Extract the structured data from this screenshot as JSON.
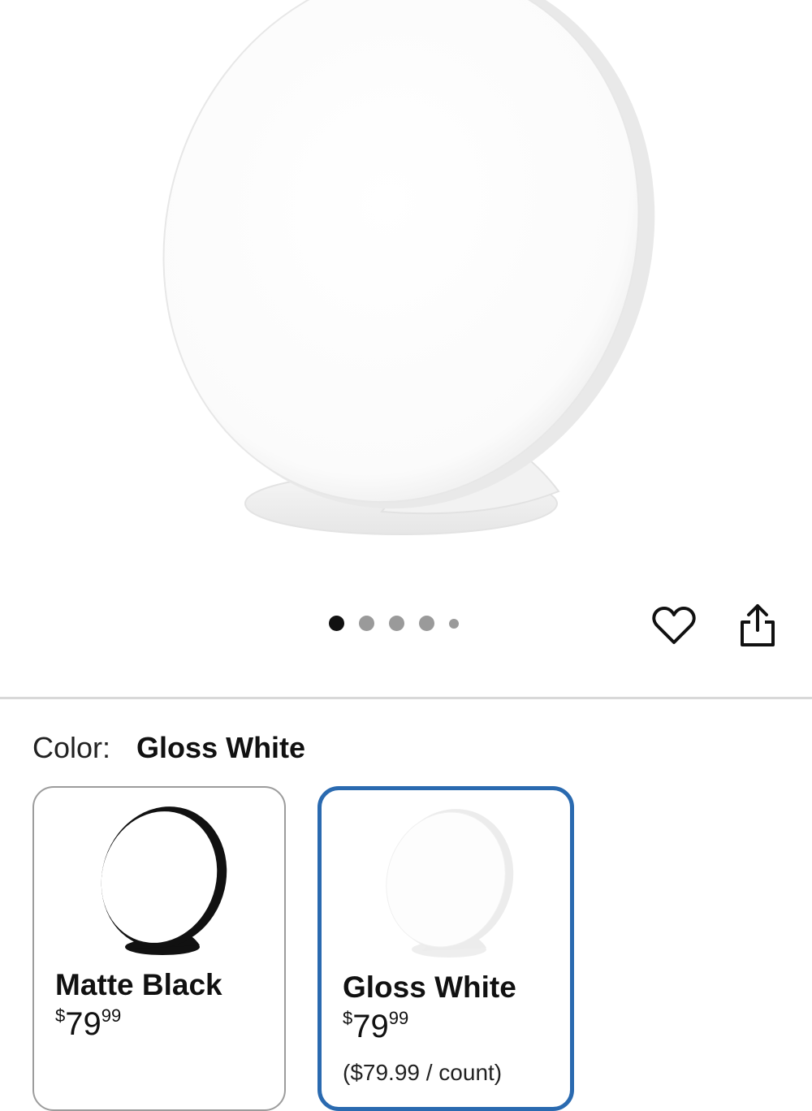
{
  "product_gallery": {
    "image_alt": "Gloss White light therapy lamp",
    "dots_count": 5,
    "active_dot": 0
  },
  "actions": {
    "favorite_icon": "heart-outline-icon",
    "share_icon": "share-icon"
  },
  "color_selector": {
    "label": "Color:",
    "selected_value": "Gloss White",
    "options": [
      {
        "name": "Matte Black",
        "price_currency": "$",
        "price_whole": "79",
        "price_fraction": "99",
        "unit_price": "",
        "selected": false,
        "swatch_color": "#111111"
      },
      {
        "name": "Gloss White",
        "price_currency": "$",
        "price_whole": "79",
        "price_fraction": "99",
        "unit_price": "($79.99 / count)",
        "selected": true,
        "swatch_color": "#f4f4f4"
      }
    ]
  },
  "colors": {
    "selected_border": "#2a6ab0",
    "unselected_border": "#9c9c9c",
    "divider": "#d8d8d8"
  }
}
